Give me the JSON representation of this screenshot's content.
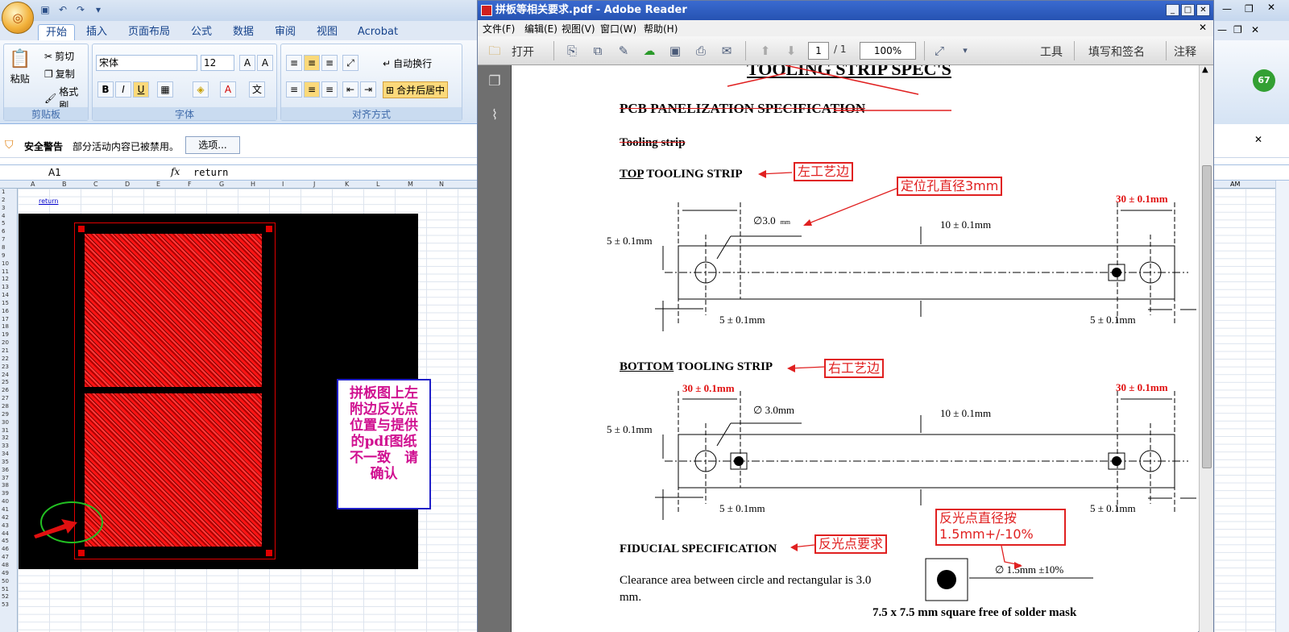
{
  "excel": {
    "tabs": [
      "开始",
      "插入",
      "页面布局",
      "公式",
      "数据",
      "审阅",
      "视图",
      "Acrobat"
    ],
    "clipboard": {
      "paste": "粘贴",
      "cut": "剪切",
      "copy": "复制",
      "format_painter": "格式刷",
      "group_label": "剪贴板"
    },
    "font": {
      "name": "宋体",
      "size": "12",
      "group_label": "字体",
      "bold": "B",
      "italic": "I",
      "underline": "U"
    },
    "alignment": {
      "wrap": "自动换行",
      "merge": "合并后居中",
      "group_label": "对齐方式"
    },
    "security": {
      "title": "安全警告",
      "message": "部分活动内容已被禁用。",
      "options_button": "选项..."
    },
    "name_box": "A1",
    "fx": "fx",
    "formula_value": "return",
    "columns": [
      "A",
      "B",
      "C",
      "D",
      "E",
      "F",
      "G",
      "H",
      "I",
      "J",
      "K",
      "L",
      "M",
      "N"
    ],
    "right_column": "AM",
    "rows": [
      "1",
      "2",
      "3",
      "4",
      "5",
      "6",
      "7",
      "8",
      "9",
      "10",
      "11",
      "12",
      "13",
      "14",
      "15",
      "16",
      "17",
      "18",
      "19",
      "20",
      "21",
      "22",
      "23",
      "24",
      "25",
      "26",
      "27",
      "28",
      "29",
      "30",
      "31",
      "32",
      "33",
      "34",
      "35",
      "36",
      "37",
      "38",
      "39",
      "40",
      "41",
      "42",
      "43",
      "44",
      "45",
      "46",
      "47",
      "48",
      "49",
      "50",
      "51",
      "52",
      "53"
    ],
    "cell_link": "return",
    "note": [
      "拼板图上左",
      "附边反光点",
      "位置与提供",
      "的pdf图纸",
      "不一致　请",
      "确认"
    ],
    "badge": "67"
  },
  "reader": {
    "title": "拼板等相关要求.pdf - Adobe Reader",
    "menu": [
      "文件(F)",
      "编辑(E)",
      "视图(V)",
      "窗口(W)",
      "帮助(H)"
    ],
    "open": "打开",
    "page_current": "1",
    "page_total": "/ 1",
    "zoom": "100%",
    "right_tools": [
      "工具",
      "填写和签名",
      "注释"
    ],
    "doc": {
      "heading": "TOOLING STRIP SPEC'S",
      "subheading": "PCB PANELIZATION SPECIFICATION",
      "tooling": "Tooling strip",
      "top_label_u": "TOP",
      "top_label_rest": " TOOLING STRIP",
      "bottom_label_u": "BOTTOM",
      "bottom_label_rest": " TOOLING STRIP",
      "dia_top": "∅3.0",
      "dia_top_unit": "mm",
      "dia_bottom": "∅ 3.0mm",
      "ten": "10 ± 0.1mm",
      "five_v": "5 ± 0.1mm",
      "five_h": "5 ± 0.1mm",
      "thirty": "30 ± 0.1mm",
      "fiducial": "FIDUCIAL SPECIFICATION",
      "clearance": "Clearance area between circle and rectangular is 3.0",
      "clearance2": "mm.",
      "fid_dia": "∅ 1.5mm ±10%",
      "square": "7.5 x 7.5 mm square free of solder mask"
    },
    "annotations": {
      "left_edge": "左工艺边",
      "hole_dia": "定位孔直径3mm",
      "right_edge": "右工艺边",
      "fid_req": "反光点要求",
      "fid_dia_line1": "反光点直径按",
      "fid_dia_line2": "1.5mm+/-10%"
    }
  }
}
